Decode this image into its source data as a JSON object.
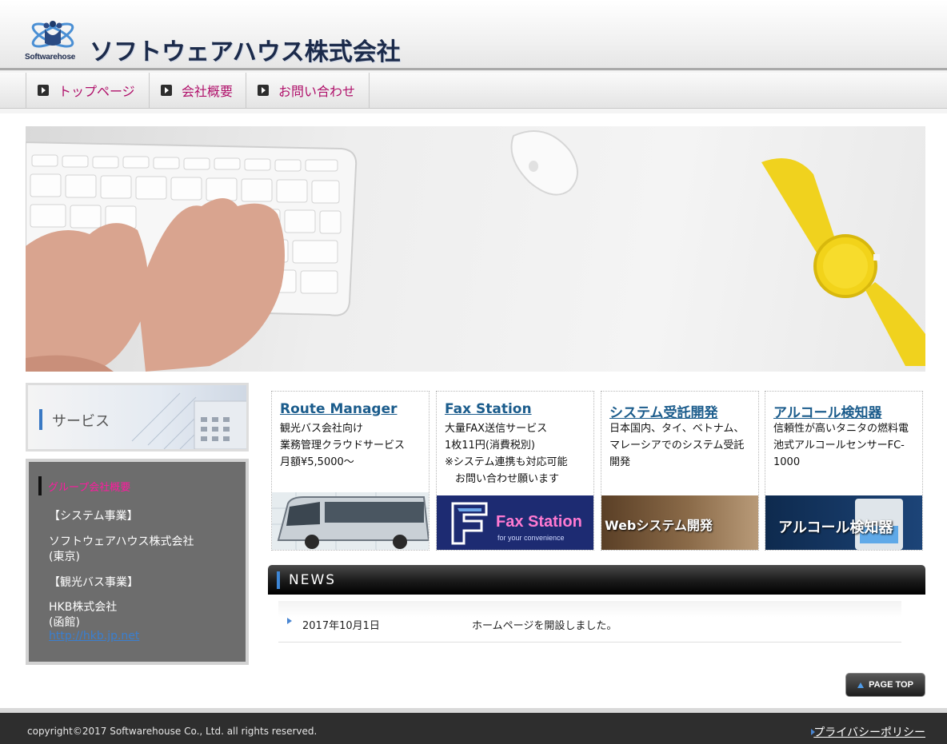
{
  "header": {
    "logo_sub": "Softwarehose",
    "company_name": "ソフトウェアハウス株式会社"
  },
  "nav": {
    "items": [
      {
        "label": "トップページ"
      },
      {
        "label": "会社概要"
      },
      {
        "label": "お問い合わせ"
      }
    ]
  },
  "sidebar": {
    "service_title": "サービス",
    "group_title": "グループ会社概要",
    "lines": [
      "【システム事業】",
      "ソフトウェアハウス株式会社",
      "(東京)",
      "【観光バス事業】",
      "HKB株式会社",
      "(函館)"
    ],
    "link": "http://hkb.jp.net"
  },
  "cards": [
    {
      "title": "Route Manager",
      "lines": [
        "観光バス会社向け",
        "業務管理クラウドサービス",
        "月額¥5,5000～"
      ],
      "image": "bus-photo"
    },
    {
      "title": "Fax Station",
      "lines": [
        "大量FAX送信サービス",
        "1枚11円(消費税別)",
        "※システム連携も対応可能",
        "　お問い合わせ願います"
      ],
      "image_text": "Fax Station",
      "image_subtext": "for your convenience"
    },
    {
      "title": "システム受託開発",
      "lines": [
        "日本国内、タイ、ベトナム、",
        "マレーシアでのシステム受託",
        "開発"
      ],
      "image_text": "Webシステム開発"
    },
    {
      "title": "アルコール検知器",
      "lines": [
        "信頼性が高いタニタの燃料電",
        "池式アルコールセンサーFC-",
        "1000"
      ],
      "image_text": "アルコール検知器"
    }
  ],
  "news": {
    "title": "NEWS",
    "items": [
      {
        "date": "2017年10月1日",
        "text": "ホームページを開設しました。"
      }
    ]
  },
  "pagetop_label": "PAGE TOP",
  "footer": {
    "copyright": "copyright©2017 Softwarehouse Co., Ltd. all rights reserved.",
    "privacy": "プライバシーポリシー"
  },
  "colors": {
    "nav_text": "#b0106a",
    "card_title": "#1b5c8c",
    "group_title": "#ff1aa0",
    "accent_blue": "#3d86d6"
  }
}
